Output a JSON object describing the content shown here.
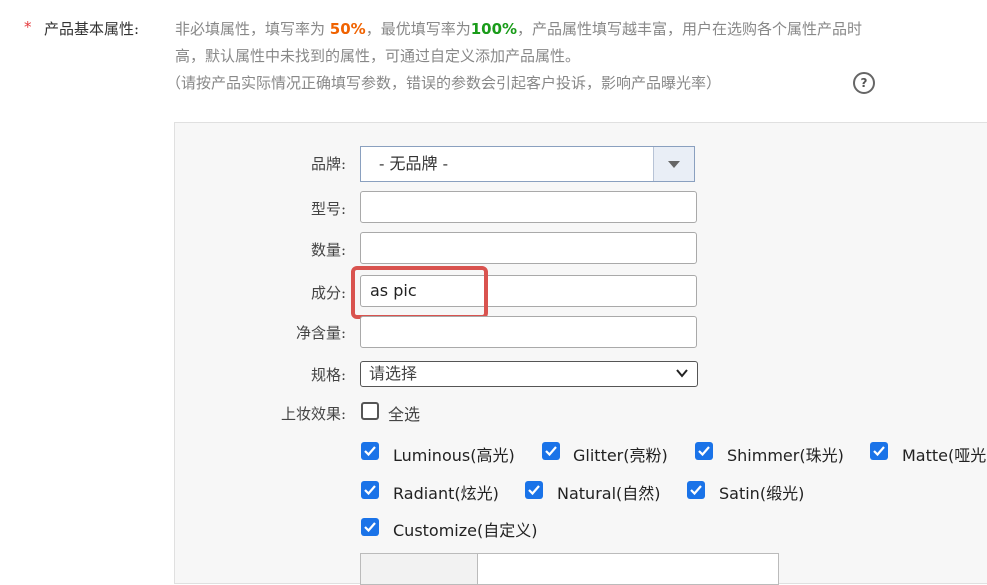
{
  "section": {
    "required_mark": "*",
    "label": "产品基本属性:",
    "intro": {
      "line1_a": "非必填属性，填写率为 ",
      "rate_min": "50%",
      "line1_b": "，最优填写率为",
      "rate_best": "100%",
      "line1_c": "，产品属性填写越丰富，用户在选购各个属性产品时",
      "line2": "高，默认属性中未找到的属性，可通过自定义添加产品属性。",
      "line3": "（请按产品实际情况正确填写参数，错误的参数会引起客户投诉，影响产品曝光率）"
    },
    "help_icon": "?"
  },
  "form": {
    "brand": {
      "label": "品牌:",
      "value": "- 无品牌 -"
    },
    "model": {
      "label": "型号:",
      "value": ""
    },
    "quantity": {
      "label": "数量:",
      "value": ""
    },
    "ingredient": {
      "label": "成分:",
      "value": "as pic"
    },
    "net_content": {
      "label": "净含量:",
      "value": ""
    },
    "spec": {
      "label": "规格:",
      "value": "请选择"
    },
    "makeup_effect": {
      "label": "上妆效果:",
      "select_all": {
        "label": "全选",
        "checked": false
      },
      "options": [
        {
          "label": "Luminous(高光)",
          "checked": true
        },
        {
          "label": "Glitter(亮粉)",
          "checked": true
        },
        {
          "label": "Shimmer(珠光)",
          "checked": true
        },
        {
          "label": "Matte(哑光",
          "checked": true
        },
        {
          "label": "Radiant(炫光)",
          "checked": true
        },
        {
          "label": "Natural(自然)",
          "checked": true
        },
        {
          "label": "Satin(缎光)",
          "checked": true
        },
        {
          "label": "Customize(自定义)",
          "checked": true
        }
      ]
    }
  },
  "colors": {
    "checkbox_blue": "#1a73e8",
    "highlight_red": "#d9534f",
    "rate_orange": "#f06200",
    "rate_green": "#1a9c1a"
  }
}
